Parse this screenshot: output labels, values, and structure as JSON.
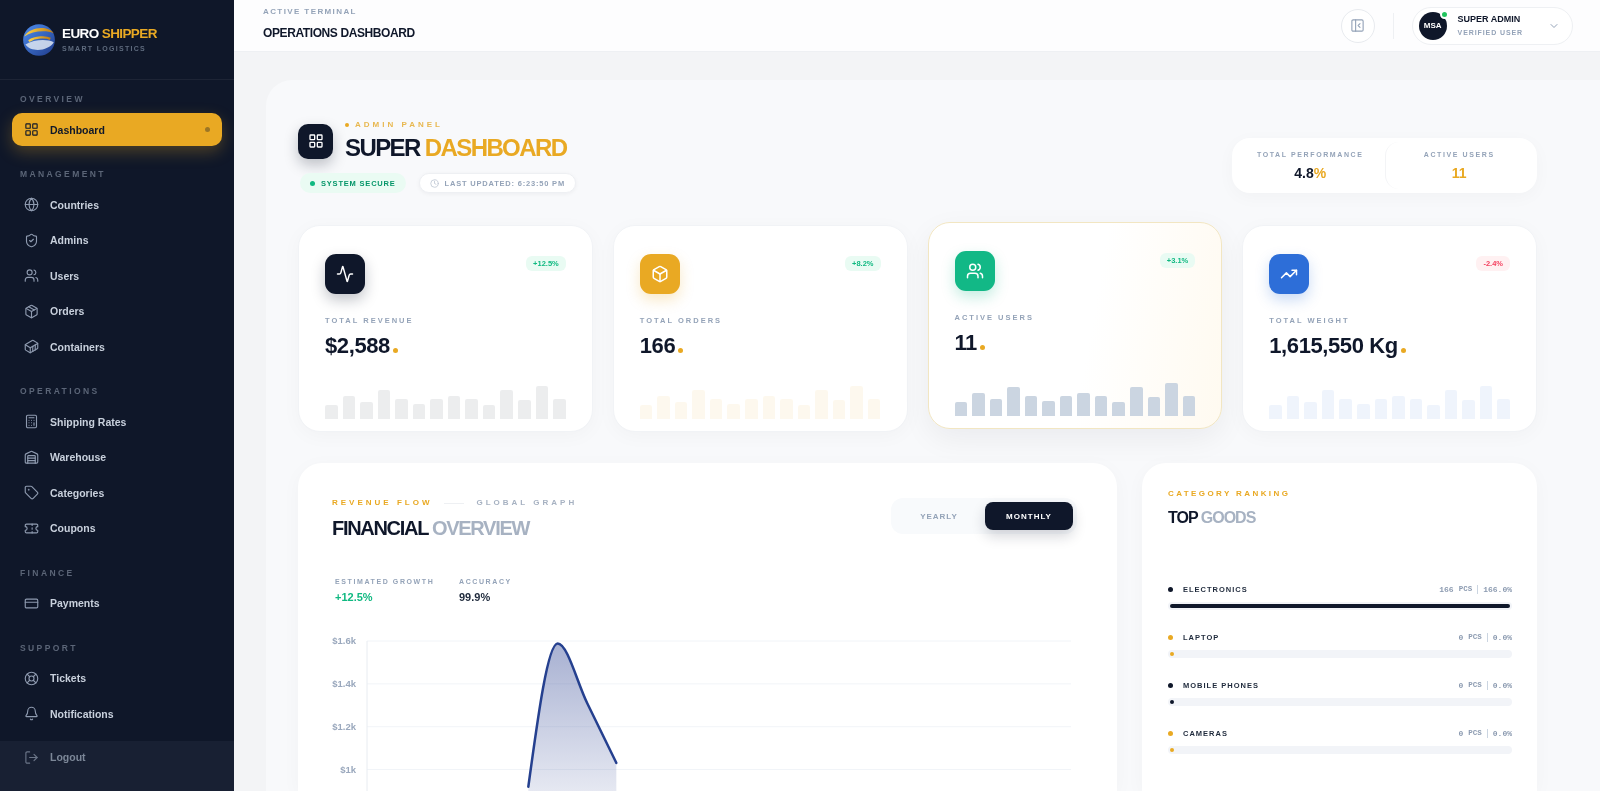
{
  "sidebar": {
    "brand": {
      "lead": "EURO",
      "accent": "SHIPPER",
      "tagline": "SMART LOGISTICS"
    },
    "sections": [
      {
        "title": "OVERVIEW",
        "items": [
          {
            "label": "Dashboard",
            "selected": true
          }
        ]
      },
      {
        "title": "MANAGEMENT",
        "items": [
          {
            "label": "Countries",
            "selected": false
          },
          {
            "label": "Admins",
            "selected": false
          },
          {
            "label": "Users",
            "selected": false
          },
          {
            "label": "Orders",
            "selected": false
          },
          {
            "label": "Containers",
            "selected": false
          }
        ]
      },
      {
        "title": "OPERATIONS",
        "items": [
          {
            "label": "Shipping Rates",
            "selected": false
          },
          {
            "label": "Warehouse",
            "selected": false
          },
          {
            "label": "Categories",
            "selected": false
          },
          {
            "label": "Coupons",
            "selected": false
          }
        ]
      },
      {
        "title": "FINANCE",
        "items": [
          {
            "label": "Payments",
            "selected": false
          }
        ]
      },
      {
        "title": "SUPPORT",
        "items": [
          {
            "label": "Tickets",
            "selected": false
          },
          {
            "label": "Notifications",
            "selected": false
          }
        ]
      }
    ],
    "logout": "Logout"
  },
  "header": {
    "eyebrow": "ACTIVE TERMINAL",
    "title": "OPERATIONS DASHBOARD",
    "user": {
      "initials": "MSA",
      "name": "SUPER ADMIN",
      "role": "VERIFIED USER",
      "online": true
    }
  },
  "hero": {
    "eyebrow": "ADMIN PANEL",
    "title": {
      "lead": "SUPER",
      "accent": "DASHBOARD"
    },
    "status": "SYSTEM SECURE",
    "updated": "LAST UPDATED: **6:23:50 PM**",
    "summary": [
      {
        "label": "TOTAL PERFORMANCE",
        "value": "4.8",
        "unit": "%",
        "kind": "ratio"
      },
      {
        "label": "ACTIVE USERS",
        "value": "11",
        "kind": "count"
      }
    ]
  },
  "stats": [
    {
      "label": "TOTAL REVENUE",
      "value": "$2,588",
      "change": "+12.5%",
      "kind": "gain",
      "color": "#0f172a",
      "highlighted": false
    },
    {
      "label": "TOTAL ORDERS",
      "value": "166",
      "change": "+8.2%",
      "kind": "gain",
      "color": "#e9a923",
      "highlighted": false
    },
    {
      "label": "ACTIVE USERS",
      "value": "11",
      "change": "+3.1%",
      "kind": "gain",
      "color": "#12b886",
      "highlighted": true
    },
    {
      "label": "TOTAL WEIGHT",
      "value": "1,615,550 Kg",
      "change": "-2.4%",
      "kind": "loss",
      "color": "#2d6ed8",
      "highlighted": false
    }
  ],
  "financial": {
    "eyebrow": "REVENUE FLOW",
    "sub_eyebrow": "GLOBAL GRAPH",
    "title": {
      "lead": "FINANCIAL",
      "accent": "OVERVIEW"
    },
    "ranges": [
      {
        "label": "YEARLY",
        "selected": false
      },
      {
        "label": "MONTHLY",
        "selected": true
      }
    ],
    "metrics": [
      {
        "label": "ESTIMATED GROWTH",
        "value": "+12.5%",
        "kind": "growth"
      },
      {
        "label": "ACCURACY",
        "value": "99.9%",
        "kind": "plain"
      }
    ],
    "chart_data": {
      "type": "area",
      "categories": [
        null,
        null,
        null,
        null,
        null,
        null,
        null,
        null,
        null,
        null,
        null,
        null,
        null,
        null,
        null,
        null,
        null,
        null,
        null,
        null,
        null,
        null,
        null,
        null
      ],
      "values": [
        null,
        null,
        null,
        null,
        null,
        920,
        1588,
        1312,
        1031,
        null,
        null,
        null,
        null,
        null,
        null,
        null,
        null,
        null,
        null,
        null,
        null,
        null,
        null,
        null
      ],
      "ylim": [
        900,
        1600
      ],
      "yticks": [
        {
          "value": 1000,
          "label": "$1k"
        },
        {
          "value": 1200,
          "label": "$1.2k"
        },
        {
          "value": 1400,
          "label": "$1.4k"
        },
        {
          "value": 1600,
          "label": "$1.6k"
        }
      ],
      "grid": true
    }
  },
  "ranking": {
    "eyebrow": "CATEGORY RANKING",
    "title": {
      "lead": "TOP",
      "accent": "GOODS"
    },
    "items": [
      {
        "name": "ELECTRONICS",
        "qty": "166",
        "unit": "PCS",
        "share": "166.0%",
        "level": 1,
        "color": "#0f172a"
      },
      {
        "name": "LAPTOP",
        "qty": "0",
        "unit": "PCS",
        "share": "0.0%",
        "level": 0,
        "color": "#e9a923"
      },
      {
        "name": "MOBILE PHONES",
        "qty": "0",
        "unit": "PCS",
        "share": "0.0%",
        "level": 0,
        "color": "#0f172a"
      },
      {
        "name": "CAMERAS",
        "qty": "0",
        "unit": "PCS",
        "share": "0.0%",
        "level": 0,
        "color": "#e9a923"
      }
    ]
  }
}
